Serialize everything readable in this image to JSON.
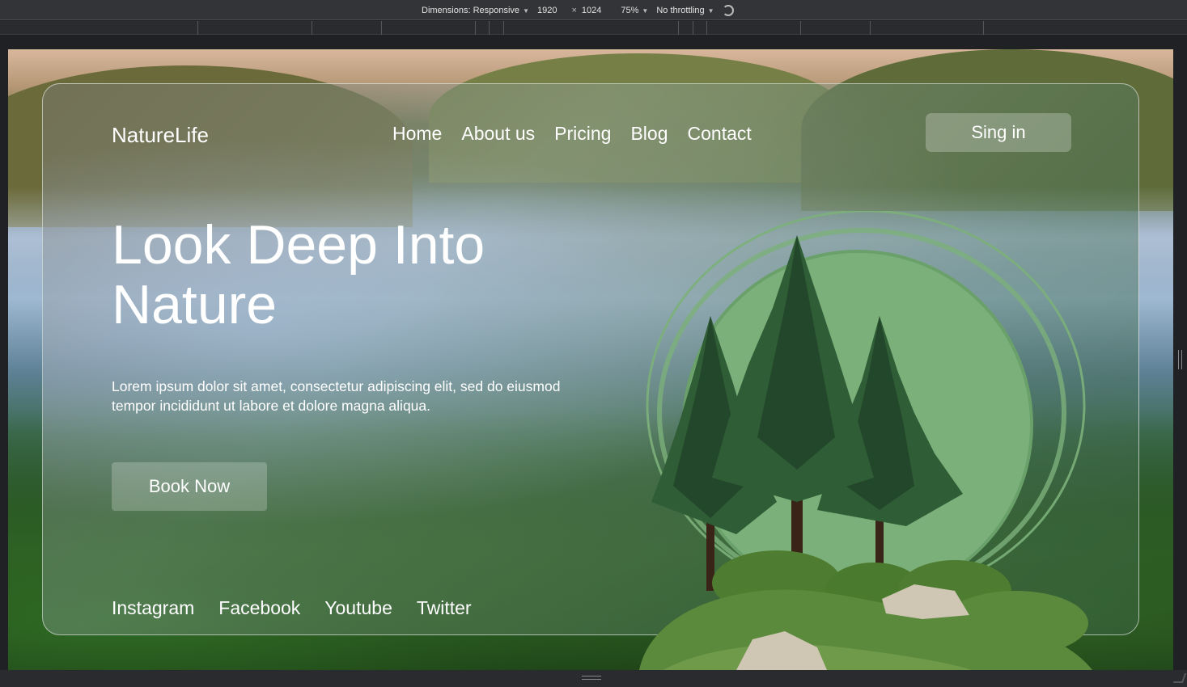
{
  "devtools": {
    "dimensions_label": "Dimensions: Responsive",
    "width": "1920",
    "times": "×",
    "height": "1024",
    "zoom": "75%",
    "throttling": "No throttling"
  },
  "site": {
    "brand": "NatureLife",
    "nav": [
      "Home",
      "About us",
      "Pricing",
      "Blog",
      "Contact"
    ],
    "signin_label": "Sing in",
    "headline": "Look Deep Into Nature",
    "lead": "Lorem ipsum dolor sit amet, consectetur adipiscing elit, sed do eiusmod tempor incididunt ut labore et dolore magna aliqua.",
    "book_label": "Book Now",
    "social": [
      "Instagram",
      "Facebook",
      "Youtube",
      "Twitter"
    ]
  },
  "colors": {
    "circle": "#7cb07a",
    "tree_dark": "#23472a",
    "tree_mid": "#2f5e36",
    "grass": "#5b8a3c",
    "rock": "#cfc6b4"
  }
}
